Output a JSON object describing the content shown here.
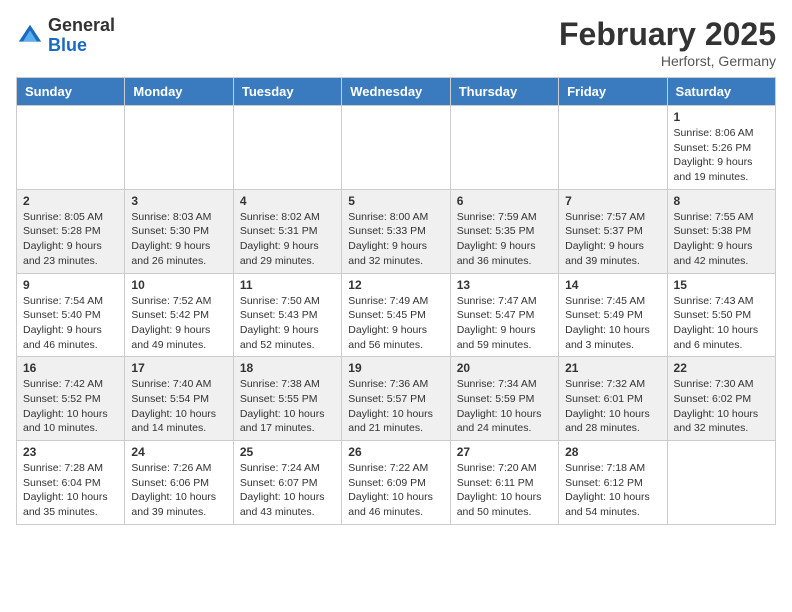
{
  "header": {
    "logo_general": "General",
    "logo_blue": "Blue",
    "month_title": "February 2025",
    "subtitle": "Herforst, Germany"
  },
  "weekdays": [
    "Sunday",
    "Monday",
    "Tuesday",
    "Wednesday",
    "Thursday",
    "Friday",
    "Saturday"
  ],
  "weeks": [
    [
      {
        "day": "",
        "info": ""
      },
      {
        "day": "",
        "info": ""
      },
      {
        "day": "",
        "info": ""
      },
      {
        "day": "",
        "info": ""
      },
      {
        "day": "",
        "info": ""
      },
      {
        "day": "",
        "info": ""
      },
      {
        "day": "1",
        "info": "Sunrise: 8:06 AM\nSunset: 5:26 PM\nDaylight: 9 hours\nand 19 minutes."
      }
    ],
    [
      {
        "day": "2",
        "info": "Sunrise: 8:05 AM\nSunset: 5:28 PM\nDaylight: 9 hours\nand 23 minutes."
      },
      {
        "day": "3",
        "info": "Sunrise: 8:03 AM\nSunset: 5:30 PM\nDaylight: 9 hours\nand 26 minutes."
      },
      {
        "day": "4",
        "info": "Sunrise: 8:02 AM\nSunset: 5:31 PM\nDaylight: 9 hours\nand 29 minutes."
      },
      {
        "day": "5",
        "info": "Sunrise: 8:00 AM\nSunset: 5:33 PM\nDaylight: 9 hours\nand 32 minutes."
      },
      {
        "day": "6",
        "info": "Sunrise: 7:59 AM\nSunset: 5:35 PM\nDaylight: 9 hours\nand 36 minutes."
      },
      {
        "day": "7",
        "info": "Sunrise: 7:57 AM\nSunset: 5:37 PM\nDaylight: 9 hours\nand 39 minutes."
      },
      {
        "day": "8",
        "info": "Sunrise: 7:55 AM\nSunset: 5:38 PM\nDaylight: 9 hours\nand 42 minutes."
      }
    ],
    [
      {
        "day": "9",
        "info": "Sunrise: 7:54 AM\nSunset: 5:40 PM\nDaylight: 9 hours\nand 46 minutes."
      },
      {
        "day": "10",
        "info": "Sunrise: 7:52 AM\nSunset: 5:42 PM\nDaylight: 9 hours\nand 49 minutes."
      },
      {
        "day": "11",
        "info": "Sunrise: 7:50 AM\nSunset: 5:43 PM\nDaylight: 9 hours\nand 52 minutes."
      },
      {
        "day": "12",
        "info": "Sunrise: 7:49 AM\nSunset: 5:45 PM\nDaylight: 9 hours\nand 56 minutes."
      },
      {
        "day": "13",
        "info": "Sunrise: 7:47 AM\nSunset: 5:47 PM\nDaylight: 9 hours\nand 59 minutes."
      },
      {
        "day": "14",
        "info": "Sunrise: 7:45 AM\nSunset: 5:49 PM\nDaylight: 10 hours\nand 3 minutes."
      },
      {
        "day": "15",
        "info": "Sunrise: 7:43 AM\nSunset: 5:50 PM\nDaylight: 10 hours\nand 6 minutes."
      }
    ],
    [
      {
        "day": "16",
        "info": "Sunrise: 7:42 AM\nSunset: 5:52 PM\nDaylight: 10 hours\nand 10 minutes."
      },
      {
        "day": "17",
        "info": "Sunrise: 7:40 AM\nSunset: 5:54 PM\nDaylight: 10 hours\nand 14 minutes."
      },
      {
        "day": "18",
        "info": "Sunrise: 7:38 AM\nSunset: 5:55 PM\nDaylight: 10 hours\nand 17 minutes."
      },
      {
        "day": "19",
        "info": "Sunrise: 7:36 AM\nSunset: 5:57 PM\nDaylight: 10 hours\nand 21 minutes."
      },
      {
        "day": "20",
        "info": "Sunrise: 7:34 AM\nSunset: 5:59 PM\nDaylight: 10 hours\nand 24 minutes."
      },
      {
        "day": "21",
        "info": "Sunrise: 7:32 AM\nSunset: 6:01 PM\nDaylight: 10 hours\nand 28 minutes."
      },
      {
        "day": "22",
        "info": "Sunrise: 7:30 AM\nSunset: 6:02 PM\nDaylight: 10 hours\nand 32 minutes."
      }
    ],
    [
      {
        "day": "23",
        "info": "Sunrise: 7:28 AM\nSunset: 6:04 PM\nDaylight: 10 hours\nand 35 minutes."
      },
      {
        "day": "24",
        "info": "Sunrise: 7:26 AM\nSunset: 6:06 PM\nDaylight: 10 hours\nand 39 minutes."
      },
      {
        "day": "25",
        "info": "Sunrise: 7:24 AM\nSunset: 6:07 PM\nDaylight: 10 hours\nand 43 minutes."
      },
      {
        "day": "26",
        "info": "Sunrise: 7:22 AM\nSunset: 6:09 PM\nDaylight: 10 hours\nand 46 minutes."
      },
      {
        "day": "27",
        "info": "Sunrise: 7:20 AM\nSunset: 6:11 PM\nDaylight: 10 hours\nand 50 minutes."
      },
      {
        "day": "28",
        "info": "Sunrise: 7:18 AM\nSunset: 6:12 PM\nDaylight: 10 hours\nand 54 minutes."
      },
      {
        "day": "",
        "info": ""
      }
    ]
  ]
}
